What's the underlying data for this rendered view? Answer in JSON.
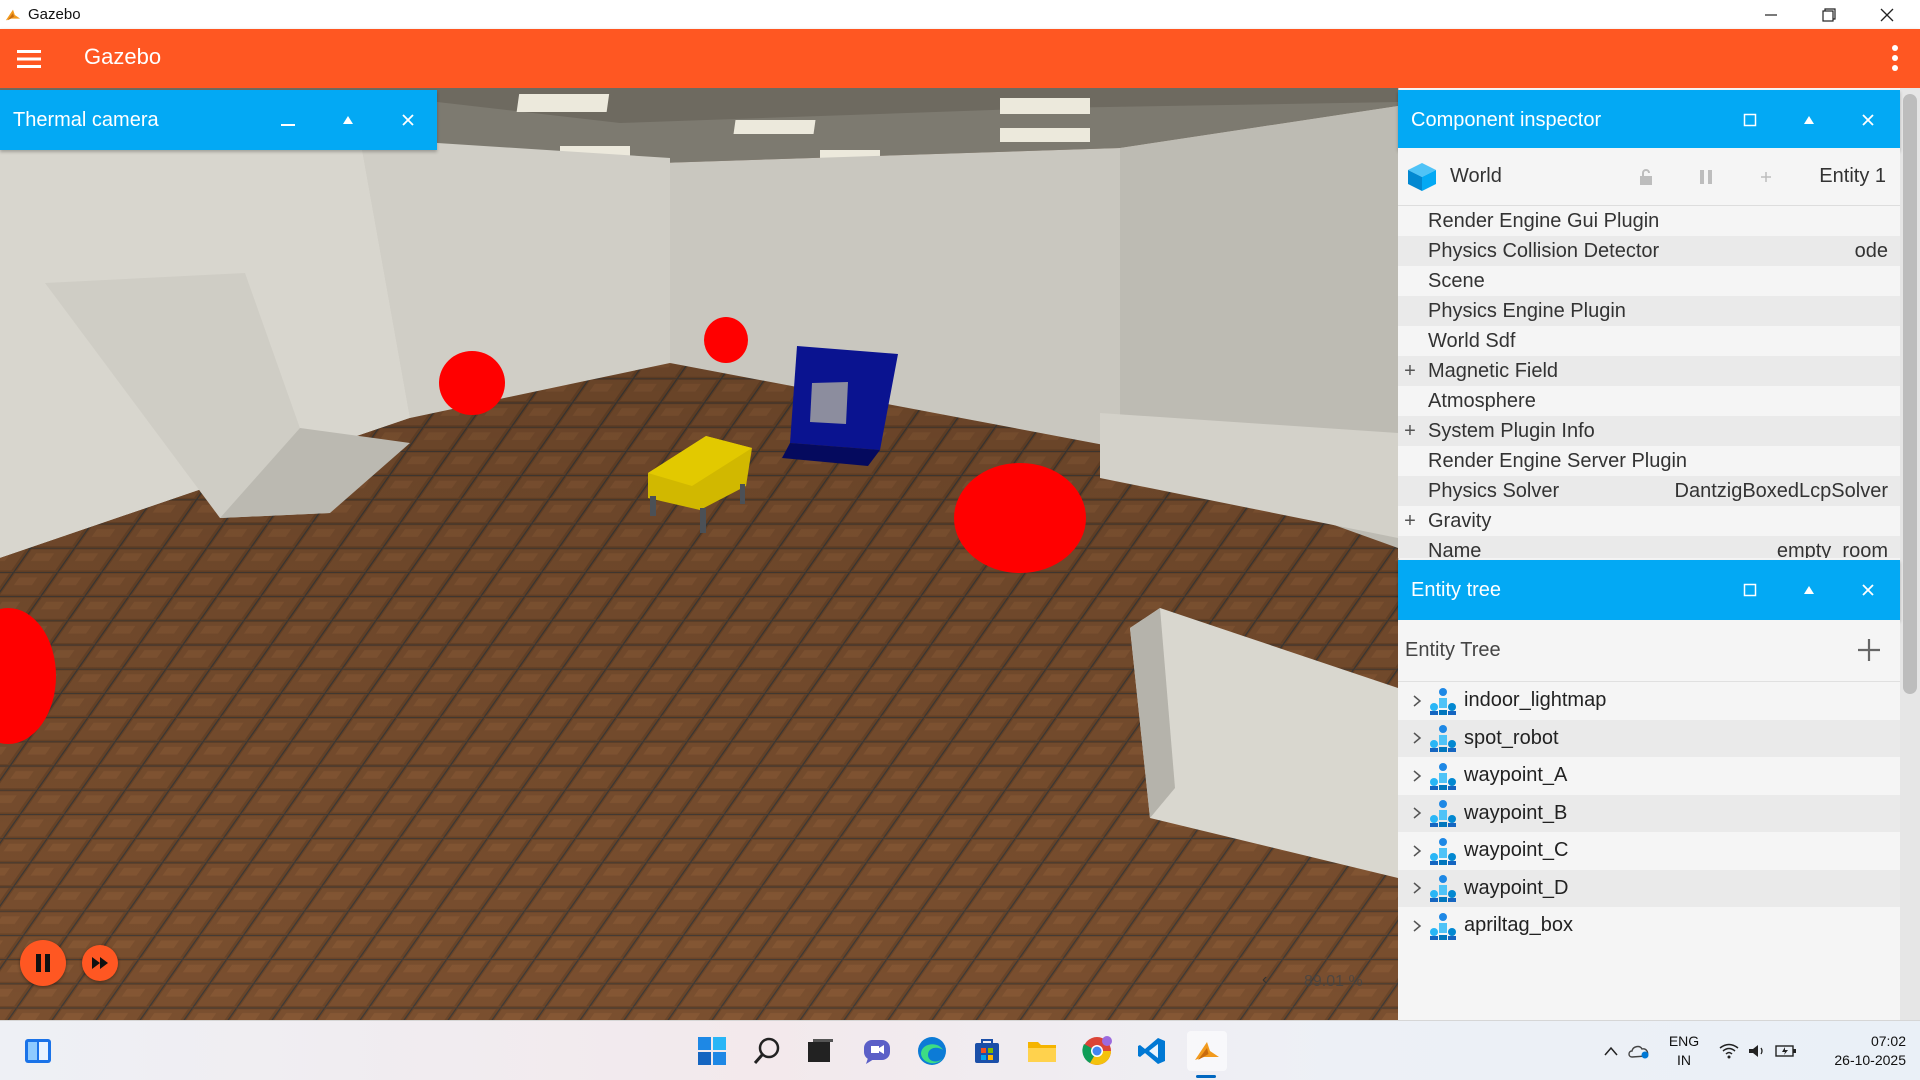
{
  "window": {
    "title": "Gazebo"
  },
  "appbar": {
    "title": "Gazebo"
  },
  "thermal_panel": {
    "title": "Thermal camera"
  },
  "scene": {
    "rtf": "89.01 %"
  },
  "inspector": {
    "title": "Component inspector",
    "world_label": "World",
    "entity_label": "Entity 1",
    "components": [
      {
        "name": "Render Engine Gui Plugin",
        "value": "",
        "expandable": false
      },
      {
        "name": "Physics Collision Detector",
        "value": "ode",
        "expandable": false
      },
      {
        "name": "Scene",
        "value": "",
        "expandable": false
      },
      {
        "name": "Physics Engine Plugin",
        "value": "",
        "expandable": false
      },
      {
        "name": "World Sdf",
        "value": "",
        "expandable": false
      },
      {
        "name": "Magnetic Field",
        "value": "",
        "expandable": true
      },
      {
        "name": "Atmosphere",
        "value": "",
        "expandable": false
      },
      {
        "name": "System Plugin Info",
        "value": "",
        "expandable": true
      },
      {
        "name": "Render Engine Server Plugin",
        "value": "",
        "expandable": false
      },
      {
        "name": "Physics Solver",
        "value": "DantzigBoxedLcpSolver",
        "expandable": false
      },
      {
        "name": "Gravity",
        "value": "",
        "expandable": true
      },
      {
        "name": "Name",
        "value": "empty_room",
        "expandable": false
      }
    ]
  },
  "entity_tree": {
    "title": "Entity tree",
    "header": "Entity Tree",
    "items": [
      "indoor_lightmap",
      "spot_robot",
      "waypoint_A",
      "waypoint_B",
      "waypoint_C",
      "waypoint_D",
      "apriltag_box"
    ]
  },
  "taskbar": {
    "lang1": "ENG",
    "lang2": "IN",
    "time": "07:02",
    "date": "26-10-2025"
  },
  "colors": {
    "appbar": "#FF5722",
    "panel": "#03A9F4"
  }
}
